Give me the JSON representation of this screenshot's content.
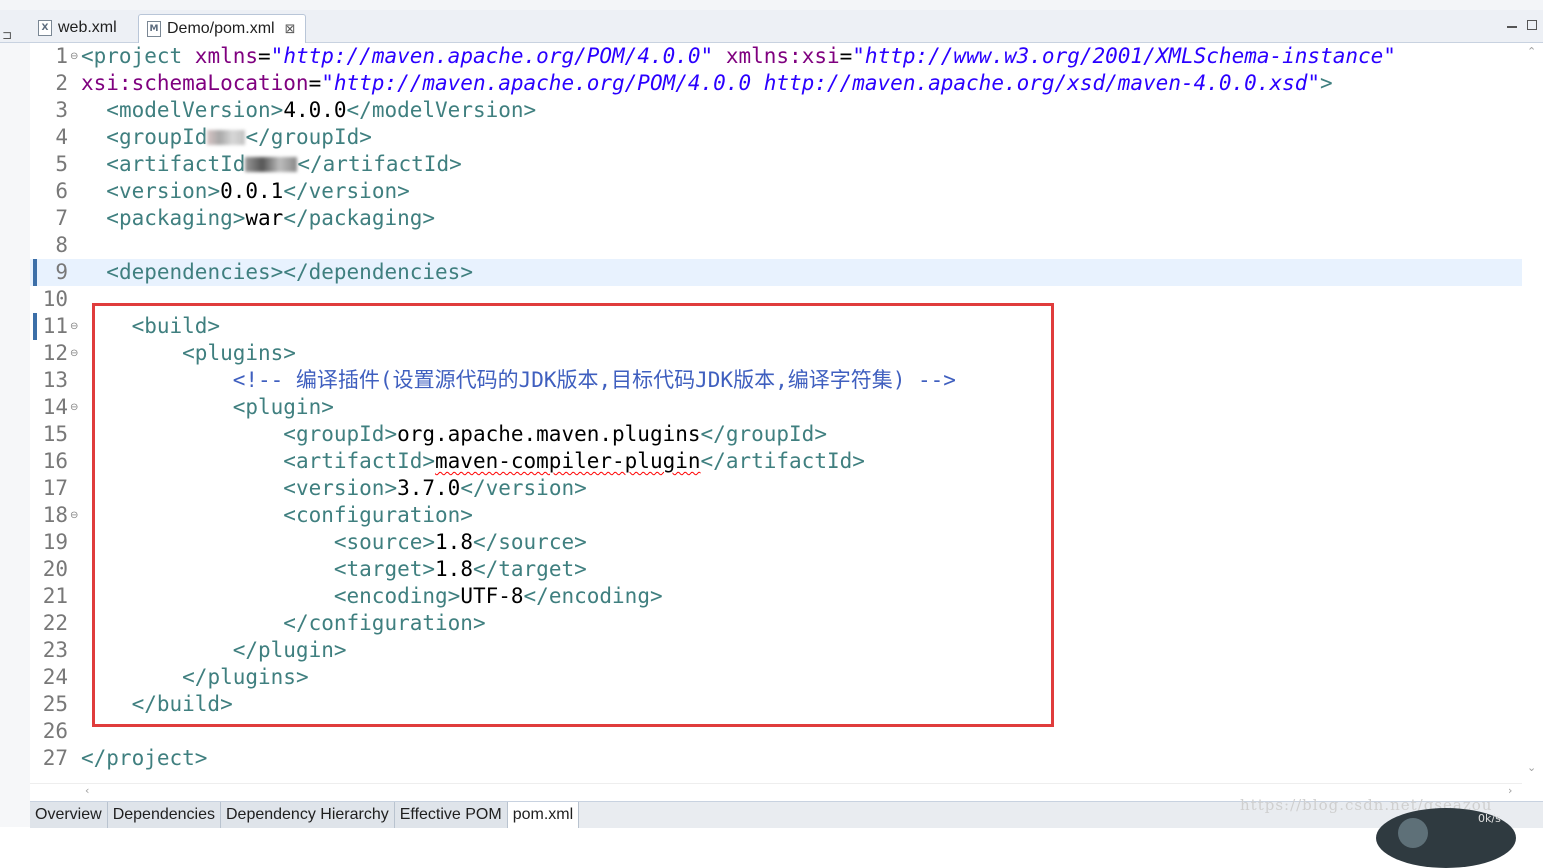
{
  "tabs": {
    "web": {
      "label": "web.xml",
      "icon": "xml-file-icon"
    },
    "pom": {
      "label": "Demo/pom.xml",
      "icon": "maven-file-icon",
      "close": "⊠"
    }
  },
  "editor": {
    "current_line": 9,
    "lines": [
      {
        "n": "1",
        "fold": "⊖"
      },
      {
        "n": "2"
      },
      {
        "n": "3"
      },
      {
        "n": "4"
      },
      {
        "n": "5"
      },
      {
        "n": "6"
      },
      {
        "n": "7"
      },
      {
        "n": "8"
      },
      {
        "n": "9"
      },
      {
        "n": "10"
      },
      {
        "n": "11",
        "fold": "⊖"
      },
      {
        "n": "12",
        "fold": "⊖"
      },
      {
        "n": "13"
      },
      {
        "n": "14",
        "fold": "⊖"
      },
      {
        "n": "15"
      },
      {
        "n": "16"
      },
      {
        "n": "17"
      },
      {
        "n": "18",
        "fold": "⊖"
      },
      {
        "n": "19"
      },
      {
        "n": "20"
      },
      {
        "n": "21"
      },
      {
        "n": "22"
      },
      {
        "n": "23"
      },
      {
        "n": "24"
      },
      {
        "n": "25"
      },
      {
        "n": "26"
      },
      {
        "n": "27"
      }
    ],
    "code": {
      "l1_open": "<project ",
      "l1_attr1": "xmlns",
      "l1_eq": "=",
      "l1_val1": "\"http://maven.apache.org/POM/4.0.0\"",
      "l1_attr2": " xmlns:xsi",
      "l1_val2": "\"http://www.w3.org/2001/XMLSchema-instance\"",
      "l2_attr": "xsi:schemaLocation",
      "l2_val": "\"http://maven.apache.org/POM/4.0.0 http://maven.apache.org/xsd/maven-4.0.0.xsd\"",
      "l2_close": ">",
      "model_open": "<modelVersion>",
      "model_val": "4.0.0",
      "model_close": "</modelVersion>",
      "group_open": "<groupId>",
      "group_close": "</groupId>",
      "artifact_open": "<artifactId>",
      "artifact_close": "</artifactId>",
      "version_open": "<version>",
      "version_val": "0.0.1",
      "version_close": "</version>",
      "packaging_open": "<packaging>",
      "packaging_val": "war",
      "packaging_close": "</packaging>",
      "deps_open": "<dependencies>",
      "deps_close": "</dependencies>",
      "build_open": "<build>",
      "plugins_open": "<plugins>",
      "comment": "<!-- 编译插件(设置源代码的JDK版本,目标代码JDK版本,编译字符集) -->",
      "plugin_open": "<plugin>",
      "p_group_val": "org.apache.maven.plugins",
      "p_artifact_val": "maven-compiler-plugin",
      "p_version_val": "3.7.0",
      "config_open": "<configuration>",
      "source_open": "<source>",
      "source_val": "1.8",
      "source_close": "</source>",
      "target_open": "<target>",
      "target_val": "1.8",
      "target_close": "</target>",
      "encoding_open": "<encoding>",
      "encoding_val": "UTF-8",
      "encoding_close": "</encoding>",
      "config_close": "</configuration>",
      "plugin_close": "</plugin>",
      "plugins_close": "</plugins>",
      "build_close": "</build>",
      "project_close": "</project>"
    }
  },
  "bottom_tabs": [
    "Overview",
    "Dependencies",
    "Dependency Hierarchy",
    "Effective POM",
    "pom.xml"
  ],
  "active_bottom_tab": "pom.xml",
  "watermark": "https://blog.csdn.net/gseazou",
  "overlay_text": "0k/s",
  "colors": {
    "tag": "#3f7f7f",
    "attribute": "#7f007f",
    "string": "#2a00ff",
    "comment": "#3f5fbf",
    "highlight_box": "#e03c3c",
    "current_line": "#e8f2fe"
  }
}
